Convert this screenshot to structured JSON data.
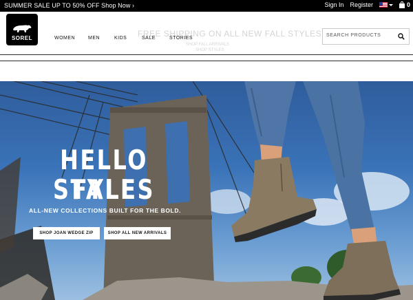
{
  "promo": {
    "text": "SUMMER SALE UP TO 50% OFF Shop Now ›"
  },
  "utility": {
    "sign_in": "Sign In",
    "register": "Register",
    "flag_icon": "us-flag-icon",
    "cart_count": "0"
  },
  "header": {
    "logo_text": "SOREL",
    "nav": [
      {
        "label": "WOMEN"
      },
      {
        "label": "MEN"
      },
      {
        "label": "KIDS"
      },
      {
        "label": "SALE"
      },
      {
        "label": "STORIES"
      }
    ],
    "ghost_banner": {
      "main": "FREE SHIPPING ON ALL NEW FALL STYLES",
      "sub1": "SHOP FALL ARRIVALS",
      "sub2": "SHOP STYLES"
    },
    "search": {
      "placeholder": "SEARCH PRODUCTS",
      "value": ""
    }
  },
  "hero": {
    "title_line1": "HELLO FALL",
    "title_line2": "STYLES",
    "subtitle": "ALL-NEW COLLECTIONS BUILT FOR THE BOLD.",
    "cta_primary": "SHOP JOAN WEDGE ZIP",
    "cta_secondary": "SHOP ALL NEW ARRIVALS"
  },
  "colors": {
    "promo_bg": "#000000",
    "header_text": "#111111",
    "hero_sky": "#3a73b8",
    "cta_bg": "#ffffff"
  }
}
